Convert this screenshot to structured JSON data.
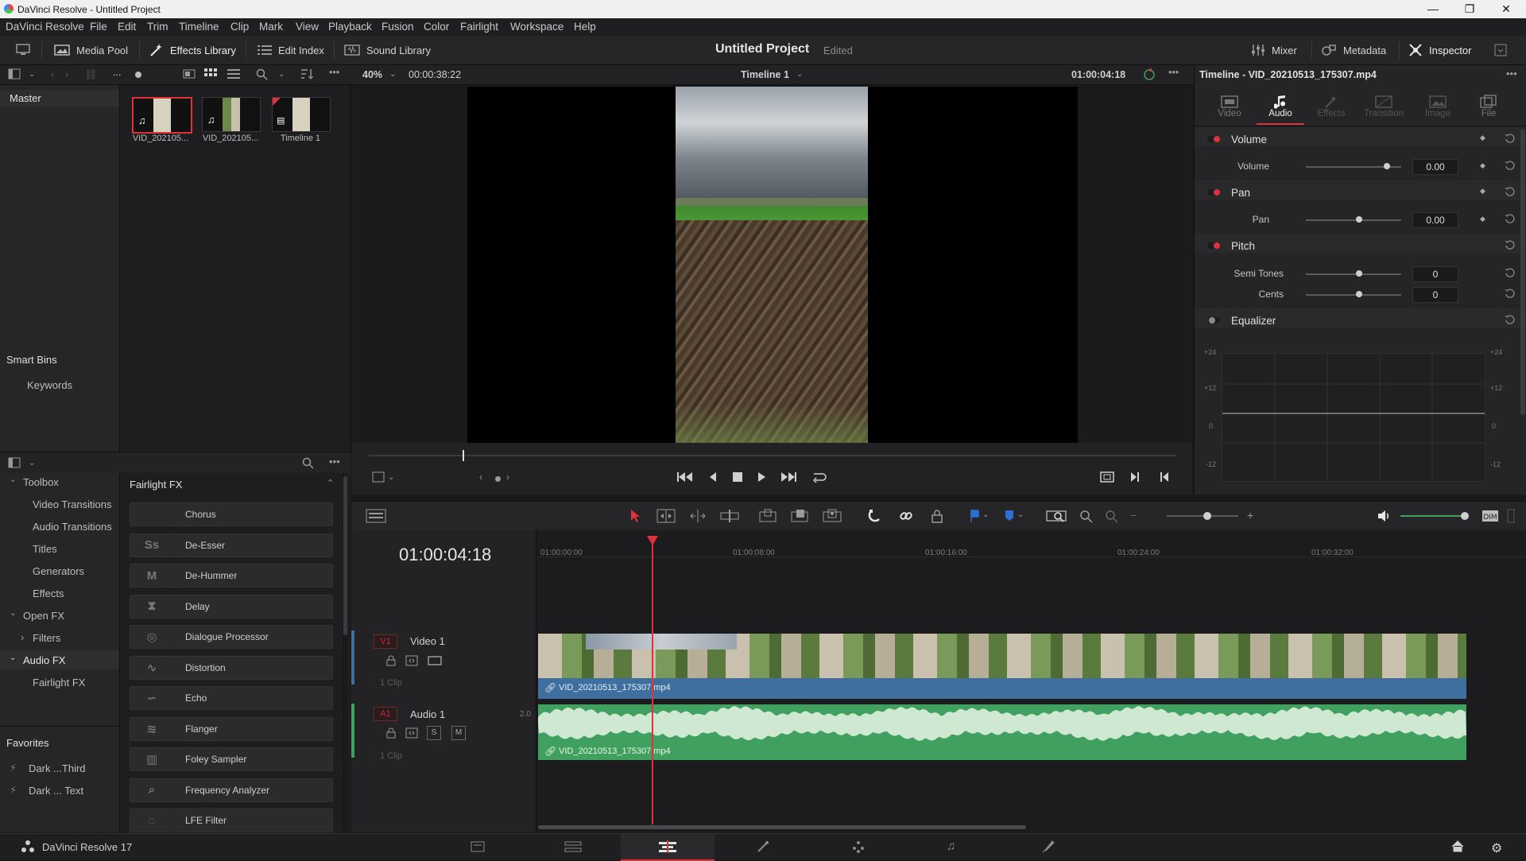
{
  "window": {
    "title": "DaVinci Resolve - Untitled Project",
    "controls": [
      "—",
      "❐",
      "✕"
    ]
  },
  "menu": [
    "DaVinci Resolve",
    "File",
    "Edit",
    "Trim",
    "Timeline",
    "Clip",
    "Mark",
    "View",
    "Playback",
    "Fusion",
    "Color",
    "Fairlight",
    "Workspace",
    "Help"
  ],
  "toolbar": {
    "media_pool": "Media Pool",
    "effects_library": "Effects Library",
    "edit_index": "Edit Index",
    "sound_library": "Sound Library",
    "project_title": "Untitled Project",
    "project_status": "Edited",
    "mixer": "Mixer",
    "metadata": "Metadata",
    "inspector": "Inspector"
  },
  "subbar": {
    "more": "...",
    "zoom": "40%",
    "duration": "00:00:38:22",
    "timeline_name": "Timeline 1",
    "timecode": "01:00:04:18"
  },
  "media_pool": {
    "master_label": "Master",
    "smart_bins_label": "Smart Bins",
    "keywords_label": "Keywords",
    "clips": [
      {
        "name": "VID_202105..."
      },
      {
        "name": "VID_202105..."
      },
      {
        "name": "Timeline 1"
      }
    ]
  },
  "effects": {
    "tree": {
      "toolbox": "Toolbox",
      "video_transitions": "Video Transitions",
      "audio_transitions": "Audio Transitions",
      "titles": "Titles",
      "generators": "Generators",
      "effects": "Effects",
      "open_fx": "Open FX",
      "filters": "Filters",
      "audio_fx": "Audio FX",
      "fairlight_fx": "Fairlight FX"
    },
    "favorites_label": "Favorites",
    "favorites": [
      "Dark ...Third",
      "Dark ... Text"
    ],
    "list_title": "Fairlight FX",
    "items": [
      {
        "label": "Chorus",
        "icon": "chorus-icon",
        "glyph": ""
      },
      {
        "label": "De-Esser",
        "icon": "de-esser-icon",
        "glyph": "Ss"
      },
      {
        "label": "De-Hummer",
        "icon": "de-hummer-icon",
        "glyph": "M"
      },
      {
        "label": "Delay",
        "icon": "delay-icon",
        "glyph": "⧗"
      },
      {
        "label": "Dialogue Processor",
        "icon": "dialogue-icon",
        "glyph": "◎"
      },
      {
        "label": "Distortion",
        "icon": "distortion-icon",
        "glyph": "∿"
      },
      {
        "label": "Echo",
        "icon": "echo-icon",
        "glyph": "∽"
      },
      {
        "label": "Flanger",
        "icon": "flanger-icon",
        "glyph": "≋"
      },
      {
        "label": "Foley Sampler",
        "icon": "foley-icon",
        "glyph": "▥"
      },
      {
        "label": "Frequency Analyzer",
        "icon": "frequency-icon",
        "glyph": "⌕"
      },
      {
        "label": "LFE Filter",
        "icon": "lfe-icon",
        "glyph": "◌"
      }
    ]
  },
  "timeline": {
    "current_timecode": "01:00:04:18",
    "ruler_labels": [
      "01:00:00:00",
      "01:00:08:00",
      "01:00:16:00",
      "01:00:24:00",
      "01:00:32:00"
    ],
    "video_track": {
      "badge": "V1",
      "name": "Video 1",
      "clip_count": "1 Clip",
      "clip_name": "VID_20210513_175307.mp4"
    },
    "audio_track": {
      "badge": "A1",
      "name": "Audio 1",
      "channels": "2.0",
      "solo": "S",
      "mute": "M",
      "clip_count": "1 Clip",
      "clip_name": "VID_20210513_175307.mp4"
    }
  },
  "inspector": {
    "title": "Timeline - VID_20210513_175307.mp4",
    "tabs": [
      "Video",
      "Audio",
      "Effects",
      "Transition",
      "Image",
      "File"
    ],
    "active_tab": "Audio",
    "volume": {
      "title": "Volume",
      "label": "Volume",
      "value": "0.00"
    },
    "pan": {
      "title": "Pan",
      "label": "Pan",
      "value": "0.00"
    },
    "pitch": {
      "title": "Pitch",
      "semi_label": "Semi Tones",
      "semi_value": "0",
      "cents_label": "Cents",
      "cents_value": "0"
    },
    "equalizer": {
      "title": "Equalizer",
      "db_labels": [
        "+24",
        "+12",
        "0",
        "-12"
      ]
    }
  },
  "footer": {
    "app_name": "DaVinci Resolve 17"
  },
  "colors": {
    "accent_red": "#e0323c",
    "clip_blue": "#3f6f9e",
    "audio_green": "#3fa060"
  }
}
